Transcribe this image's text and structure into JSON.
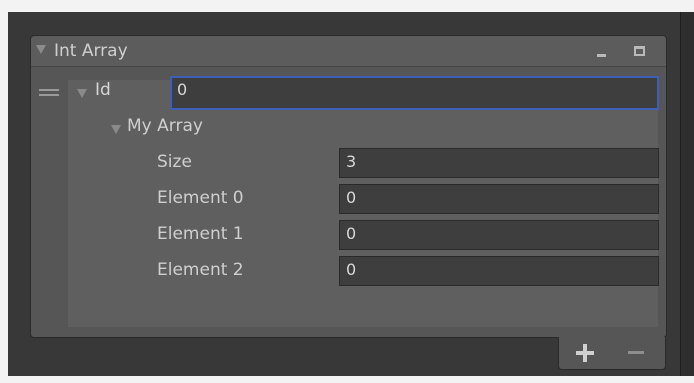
{
  "panel": {
    "title": "Int Array"
  },
  "id_row": {
    "label": "Id",
    "value": "0"
  },
  "array": {
    "label": "My Array",
    "size_label": "Size",
    "size_value": "3",
    "elements": [
      {
        "label": "Element 0",
        "value": "0"
      },
      {
        "label": "Element 1",
        "value": "0"
      },
      {
        "label": "Element 2",
        "value": "0"
      }
    ]
  },
  "icons": {
    "collapse": "triangle-down-icon",
    "minimize": "minimize-icon",
    "maximize": "maximize-icon",
    "drag": "drag-handle-icon",
    "add": "plus-icon",
    "remove": "minus-icon"
  },
  "colors": {
    "focus_border": "#3d5fb5",
    "panel_bg": "#565656",
    "field_bg": "#3e3e3e"
  }
}
